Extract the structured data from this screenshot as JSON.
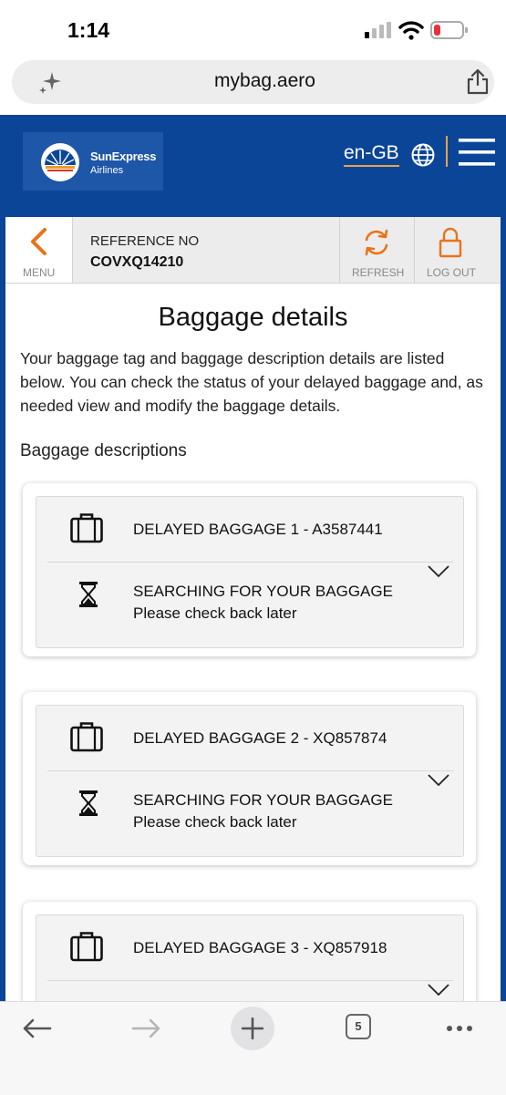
{
  "status_bar": {
    "time": "1:14"
  },
  "browser": {
    "url": "mybag.aero",
    "tab_count": "5"
  },
  "header": {
    "brand_name": "SunExpress",
    "brand_sub": "Airlines",
    "language": "en-GB"
  },
  "topbar": {
    "menu_label": "MENU",
    "reference_label": "REFERENCE NO",
    "reference_value": "COVXQ14210",
    "refresh_label": "REFRESH",
    "logout_label": "LOG OUT"
  },
  "page": {
    "title": "Baggage details",
    "intro": "Your baggage tag and baggage description details are listed below. You can check the status of your delayed baggage and, as needed view and modify the baggage details.",
    "section_title": "Baggage descriptions"
  },
  "baggage": [
    {
      "title": "DELAYED BAGGAGE 1 - A3587441",
      "status": "SEARCHING FOR YOUR BAGGAGE",
      "note": "Please check back later"
    },
    {
      "title": "DELAYED BAGGAGE 2 - XQ857874",
      "status": "SEARCHING FOR YOUR BAGGAGE",
      "note": "Please check back later"
    },
    {
      "title": "DELAYED BAGGAGE 3 - XQ857918",
      "status": "",
      "note": ""
    }
  ],
  "colors": {
    "brand_blue": "#0b4597",
    "accent_orange": "#e8731a",
    "lang_underline": "#e9a24a"
  }
}
